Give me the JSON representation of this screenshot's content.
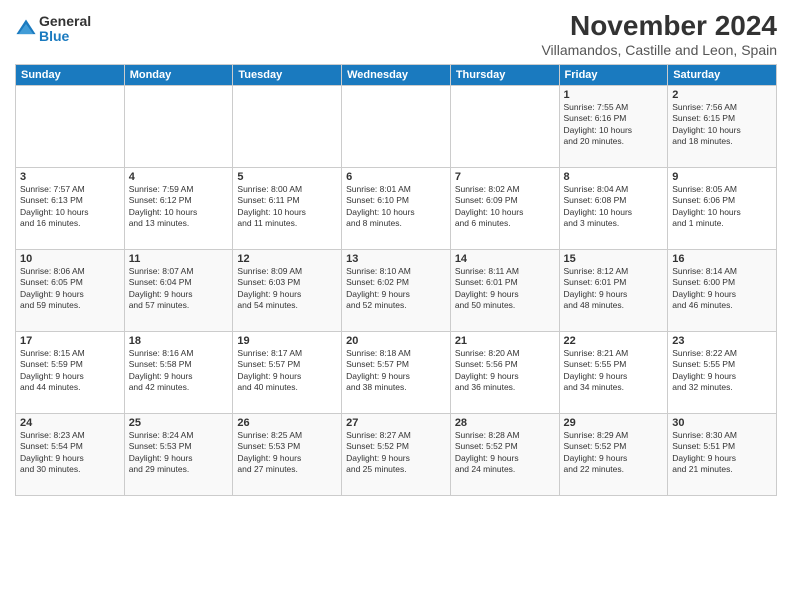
{
  "logo": {
    "general": "General",
    "blue": "Blue"
  },
  "header": {
    "month": "November 2024",
    "location": "Villamandos, Castille and Leon, Spain"
  },
  "days_of_week": [
    "Sunday",
    "Monday",
    "Tuesday",
    "Wednesday",
    "Thursday",
    "Friday",
    "Saturday"
  ],
  "weeks": [
    [
      {
        "day": "",
        "info": ""
      },
      {
        "day": "",
        "info": ""
      },
      {
        "day": "",
        "info": ""
      },
      {
        "day": "",
        "info": ""
      },
      {
        "day": "",
        "info": ""
      },
      {
        "day": "1",
        "info": "Sunrise: 7:55 AM\nSunset: 6:16 PM\nDaylight: 10 hours\nand 20 minutes."
      },
      {
        "day": "2",
        "info": "Sunrise: 7:56 AM\nSunset: 6:15 PM\nDaylight: 10 hours\nand 18 minutes."
      }
    ],
    [
      {
        "day": "3",
        "info": "Sunrise: 7:57 AM\nSunset: 6:13 PM\nDaylight: 10 hours\nand 16 minutes."
      },
      {
        "day": "4",
        "info": "Sunrise: 7:59 AM\nSunset: 6:12 PM\nDaylight: 10 hours\nand 13 minutes."
      },
      {
        "day": "5",
        "info": "Sunrise: 8:00 AM\nSunset: 6:11 PM\nDaylight: 10 hours\nand 11 minutes."
      },
      {
        "day": "6",
        "info": "Sunrise: 8:01 AM\nSunset: 6:10 PM\nDaylight: 10 hours\nand 8 minutes."
      },
      {
        "day": "7",
        "info": "Sunrise: 8:02 AM\nSunset: 6:09 PM\nDaylight: 10 hours\nand 6 minutes."
      },
      {
        "day": "8",
        "info": "Sunrise: 8:04 AM\nSunset: 6:08 PM\nDaylight: 10 hours\nand 3 minutes."
      },
      {
        "day": "9",
        "info": "Sunrise: 8:05 AM\nSunset: 6:06 PM\nDaylight: 10 hours\nand 1 minute."
      }
    ],
    [
      {
        "day": "10",
        "info": "Sunrise: 8:06 AM\nSunset: 6:05 PM\nDaylight: 9 hours\nand 59 minutes."
      },
      {
        "day": "11",
        "info": "Sunrise: 8:07 AM\nSunset: 6:04 PM\nDaylight: 9 hours\nand 57 minutes."
      },
      {
        "day": "12",
        "info": "Sunrise: 8:09 AM\nSunset: 6:03 PM\nDaylight: 9 hours\nand 54 minutes."
      },
      {
        "day": "13",
        "info": "Sunrise: 8:10 AM\nSunset: 6:02 PM\nDaylight: 9 hours\nand 52 minutes."
      },
      {
        "day": "14",
        "info": "Sunrise: 8:11 AM\nSunset: 6:01 PM\nDaylight: 9 hours\nand 50 minutes."
      },
      {
        "day": "15",
        "info": "Sunrise: 8:12 AM\nSunset: 6:01 PM\nDaylight: 9 hours\nand 48 minutes."
      },
      {
        "day": "16",
        "info": "Sunrise: 8:14 AM\nSunset: 6:00 PM\nDaylight: 9 hours\nand 46 minutes."
      }
    ],
    [
      {
        "day": "17",
        "info": "Sunrise: 8:15 AM\nSunset: 5:59 PM\nDaylight: 9 hours\nand 44 minutes."
      },
      {
        "day": "18",
        "info": "Sunrise: 8:16 AM\nSunset: 5:58 PM\nDaylight: 9 hours\nand 42 minutes."
      },
      {
        "day": "19",
        "info": "Sunrise: 8:17 AM\nSunset: 5:57 PM\nDaylight: 9 hours\nand 40 minutes."
      },
      {
        "day": "20",
        "info": "Sunrise: 8:18 AM\nSunset: 5:57 PM\nDaylight: 9 hours\nand 38 minutes."
      },
      {
        "day": "21",
        "info": "Sunrise: 8:20 AM\nSunset: 5:56 PM\nDaylight: 9 hours\nand 36 minutes."
      },
      {
        "day": "22",
        "info": "Sunrise: 8:21 AM\nSunset: 5:55 PM\nDaylight: 9 hours\nand 34 minutes."
      },
      {
        "day": "23",
        "info": "Sunrise: 8:22 AM\nSunset: 5:55 PM\nDaylight: 9 hours\nand 32 minutes."
      }
    ],
    [
      {
        "day": "24",
        "info": "Sunrise: 8:23 AM\nSunset: 5:54 PM\nDaylight: 9 hours\nand 30 minutes."
      },
      {
        "day": "25",
        "info": "Sunrise: 8:24 AM\nSunset: 5:53 PM\nDaylight: 9 hours\nand 29 minutes."
      },
      {
        "day": "26",
        "info": "Sunrise: 8:25 AM\nSunset: 5:53 PM\nDaylight: 9 hours\nand 27 minutes."
      },
      {
        "day": "27",
        "info": "Sunrise: 8:27 AM\nSunset: 5:52 PM\nDaylight: 9 hours\nand 25 minutes."
      },
      {
        "day": "28",
        "info": "Sunrise: 8:28 AM\nSunset: 5:52 PM\nDaylight: 9 hours\nand 24 minutes."
      },
      {
        "day": "29",
        "info": "Sunrise: 8:29 AM\nSunset: 5:52 PM\nDaylight: 9 hours\nand 22 minutes."
      },
      {
        "day": "30",
        "info": "Sunrise: 8:30 AM\nSunset: 5:51 PM\nDaylight: 9 hours\nand 21 minutes."
      }
    ]
  ]
}
